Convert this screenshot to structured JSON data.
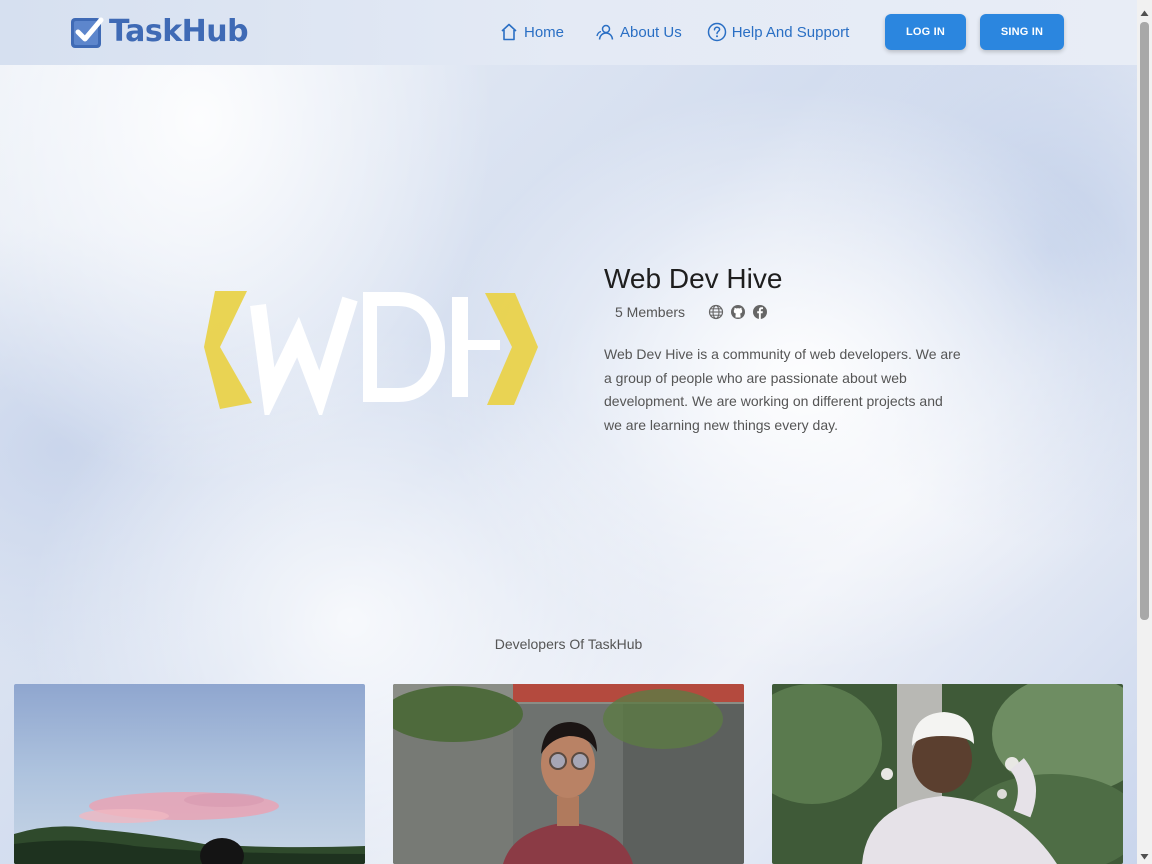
{
  "header": {
    "logo_text": "TaskHub",
    "nav": {
      "home": "Home",
      "about": "About Us",
      "help": "Help And Support"
    },
    "buttons": {
      "login": "LOG IN",
      "signin": "SING IN"
    }
  },
  "team": {
    "name": "Web Dev Hive",
    "members": "5 Members",
    "social_icons": [
      "globe-icon",
      "github-icon",
      "facebook-icon"
    ],
    "description": "Web Dev Hive is a community of web developers. We are a group of people who are passionate about web development. We are working on different projects and we are learning new things every day."
  },
  "developers": {
    "title": "Developers Of TaskHub"
  },
  "colors": {
    "brand": "#3f6ab5",
    "nav_link": "#2a6fc4",
    "button": "#2b86df",
    "logo_yellow": "#e9d24a"
  }
}
